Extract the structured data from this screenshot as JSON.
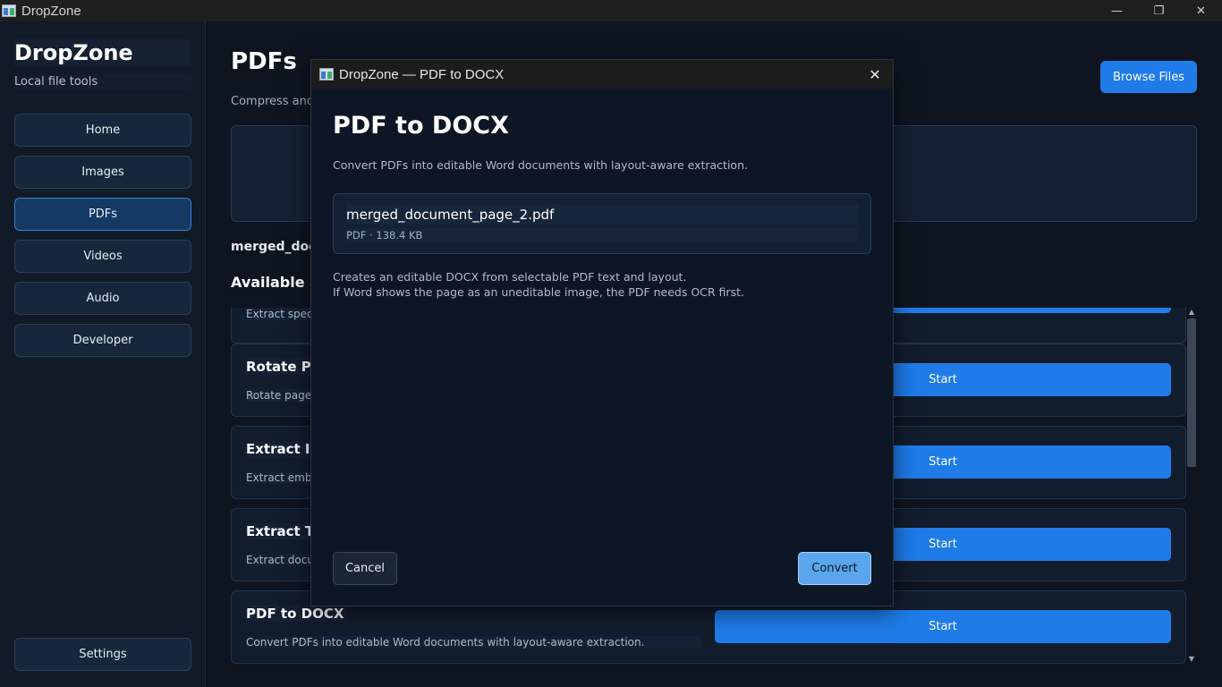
{
  "window": {
    "title": "DropZone",
    "minimize_glyph": "—",
    "maximize_glyph": "❐",
    "close_glyph": "✕"
  },
  "sidebar": {
    "brand": "DropZone",
    "subtitle": "Local file tools",
    "items": [
      {
        "label": "Home"
      },
      {
        "label": "Images"
      },
      {
        "label": "PDFs",
        "active": true
      },
      {
        "label": "Videos"
      },
      {
        "label": "Audio"
      },
      {
        "label": "Developer"
      }
    ],
    "settings_label": "Settings"
  },
  "main": {
    "title": "PDFs",
    "description": "Compress and",
    "browse_label": "Browse Files",
    "selected_file": "merged_docu",
    "actions_heading": "Available act",
    "partial_card_desc": "Extract speci",
    "cards": [
      {
        "title": "Rotate Pag",
        "desc": "Rotate page",
        "button": "Start"
      },
      {
        "title": "Extract Im",
        "desc": "Extract embe",
        "button": "Start"
      },
      {
        "title": "Extract Tex",
        "desc": "Extract docu",
        "button": "Start"
      },
      {
        "title": "PDF to DOCX",
        "desc": "Convert PDFs into editable Word documents with layout-aware extraction.",
        "button": "Start"
      }
    ]
  },
  "dialog": {
    "window_title": "DropZone — PDF to DOCX",
    "close_glyph": "✕",
    "heading": "PDF to DOCX",
    "description": "Convert PDFs into editable Word documents with layout-aware extraction.",
    "file": {
      "name": "merged_document_page_2.pdf",
      "meta": "PDF · 138.4 KB"
    },
    "note_line1": "Creates an editable DOCX from selectable PDF text and layout.",
    "note_line2": "If Word shows the page as an uneditable image, the PDF needs OCR first.",
    "cancel_label": "Cancel",
    "convert_label": "Convert"
  },
  "colors": {
    "accent": "#1e7be8",
    "background": "#0e1521",
    "dialog_background": "#0d1624"
  }
}
